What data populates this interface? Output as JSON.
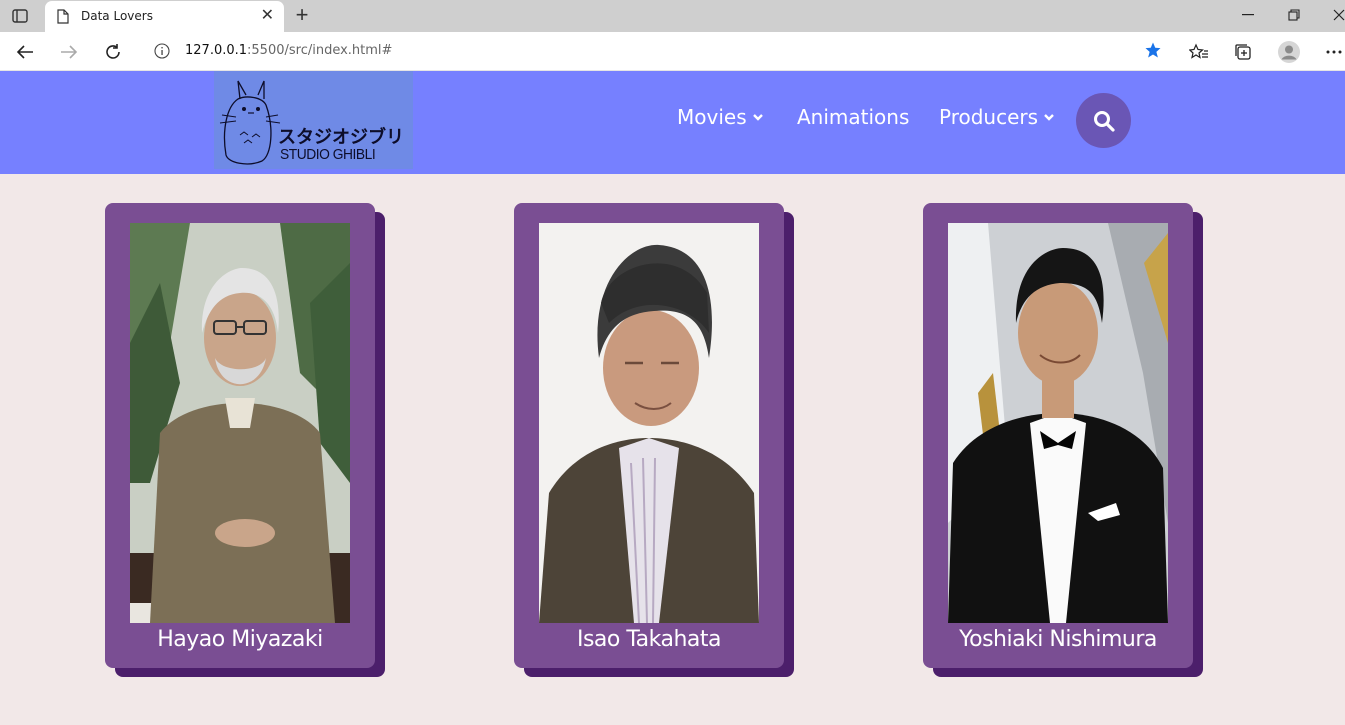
{
  "browser": {
    "tab_title": "Data Lovers",
    "url_host": "127.0.0.1",
    "url_path": ":5500/src/index.html#"
  },
  "header": {
    "logo": {
      "jp": "スタジオジブリ",
      "en": "STUDIO GHIBLI"
    },
    "menu": [
      {
        "label": "Movies",
        "has_dropdown": true
      },
      {
        "label": "Animations",
        "has_dropdown": false
      },
      {
        "label": "Producers",
        "has_dropdown": true
      }
    ],
    "search_icon": "search-icon",
    "background": "#7680ff"
  },
  "producers": [
    {
      "name": "Hayao Miyazaki"
    },
    {
      "name": "Isao Takahata"
    },
    {
      "name": "Yoshiaki Nishimura"
    }
  ],
  "colors": {
    "page_bg": "#f2e8e8",
    "card": "#7a4e93",
    "card_shadow": "#4c1f6b",
    "search_button": "#6a56b5"
  }
}
